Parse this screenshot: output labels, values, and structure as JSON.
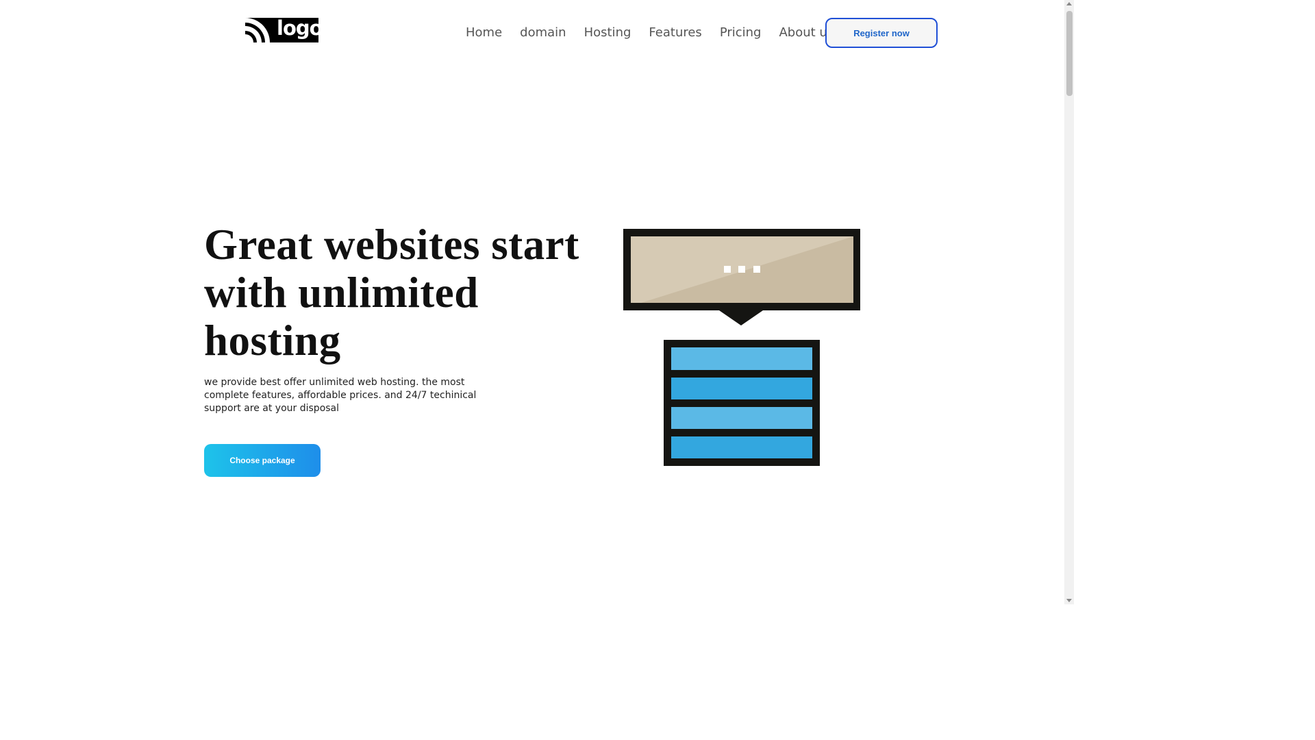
{
  "header": {
    "logo_text": "logo",
    "nav": [
      "Home",
      "domain",
      "Hosting",
      "Features",
      "Pricing",
      "About us"
    ],
    "register_label": "Register now"
  },
  "hero": {
    "title": "Great websites start with unlimited hosting",
    "description": "we provide best offer unlimited web hosting. the most complete features, affordable prices. and 24/7 techinical support are at your disposal",
    "cta_label": "Choose package"
  },
  "colors": {
    "accent_blue": "#1f4fd6",
    "cta_gradient_start": "#1ec3ea",
    "cta_gradient_end": "#1e8eea",
    "server_light": "#5bb9e6",
    "server_dark": "#33a7df",
    "bubble": "#d6cab4"
  },
  "icons": {
    "logo": "rss-feed-icon",
    "illustration": "server-with-speech-bubble"
  }
}
